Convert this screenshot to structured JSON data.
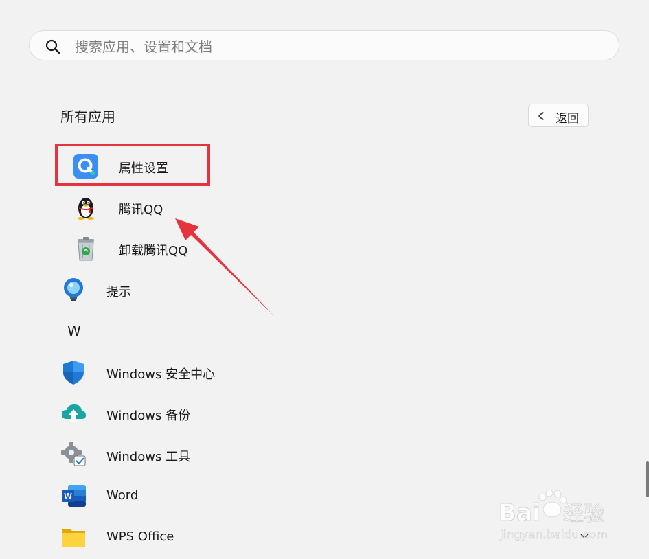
{
  "search": {
    "placeholder": "搜索应用、设置和文档",
    "value": ""
  },
  "section_title": "所有应用",
  "back_button": {
    "label": "返回"
  },
  "apps_top": [
    {
      "name": "属性设置",
      "icon": "qq-settings-icon"
    },
    {
      "name": "腾讯QQ",
      "icon": "qq-penguin-icon"
    },
    {
      "name": "卸载腾讯QQ",
      "icon": "recycle-bin-icon"
    },
    {
      "name": "提示",
      "icon": "tips-bulb-icon"
    }
  ],
  "letter_header": "W",
  "apps_w": [
    {
      "name": "Windows 安全中心",
      "icon": "security-shield-icon"
    },
    {
      "name": "Windows 备份",
      "icon": "backup-cloud-icon"
    },
    {
      "name": "Windows 工具",
      "icon": "tools-gear-icon"
    },
    {
      "name": "Word",
      "icon": "word-icon"
    },
    {
      "name": "WPS Office",
      "icon": "folder-icon"
    }
  ],
  "watermark": {
    "brand": "Baidu经验",
    "url": "jingyan.baidu.com"
  },
  "colors": {
    "highlight": "#e5343d",
    "background": "#f2f2f2"
  }
}
